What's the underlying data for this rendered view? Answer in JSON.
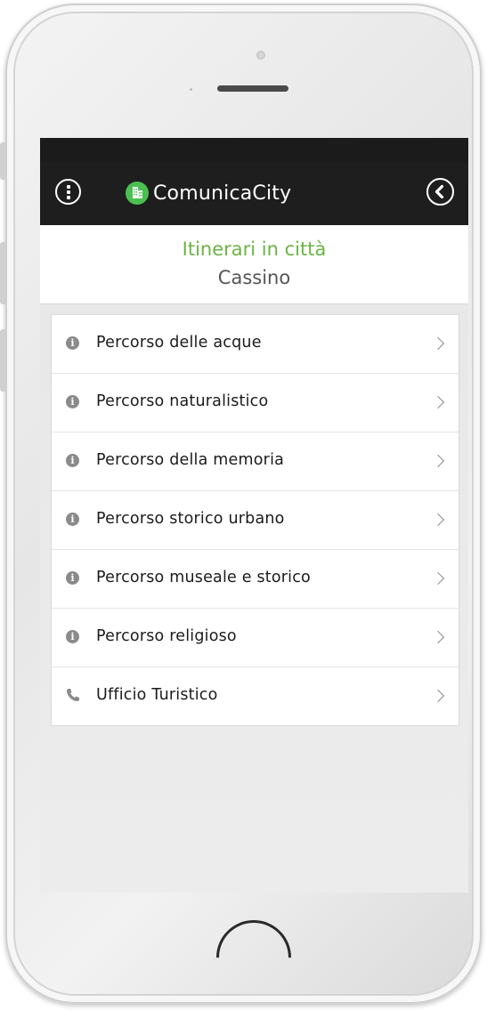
{
  "app": {
    "brand_name": "ComunicaCity",
    "brand_color": "#4bbf52"
  },
  "header": {
    "title": "Itinerari in città",
    "subtitle": "Cassino",
    "title_color": "#6bb444"
  },
  "toolbar": {
    "menu_icon": "more-vertical-icon",
    "back_icon": "chevron-left-icon"
  },
  "items": [
    {
      "label": "Percorso delle acque",
      "icon": "info-icon"
    },
    {
      "label": "Percorso naturalistico",
      "icon": "info-icon"
    },
    {
      "label": "Percorso della memoria",
      "icon": "info-icon"
    },
    {
      "label": "Percorso storico urbano",
      "icon": "info-icon"
    },
    {
      "label": "Percorso museale e storico",
      "icon": "info-icon"
    },
    {
      "label": "Percorso religioso",
      "icon": "info-icon"
    },
    {
      "label": "Ufficio Turistico",
      "icon": "phone-icon"
    }
  ]
}
